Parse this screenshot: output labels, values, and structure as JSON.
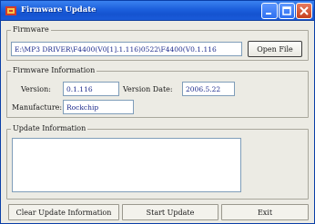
{
  "window": {
    "title": "Firmware Update"
  },
  "firmware": {
    "group_label": "Firmware",
    "path": "E:\\MP3 DRIVER\\F4400(V0[1].1.116)0522\\F4400(V0.1.116",
    "open_button": "Open File"
  },
  "info": {
    "group_label": "Firmware Information",
    "version_label": "Version:",
    "version_value": "0.1.116",
    "date_label": "Version Date:",
    "date_value": "2006.5.22",
    "manufacture_label": "Manufacture:",
    "manufacture_value": "Rockchip"
  },
  "update": {
    "group_label": "Update Information"
  },
  "buttons": {
    "clear": "Clear Update Information",
    "start": "Start Update",
    "exit": "Exit"
  }
}
